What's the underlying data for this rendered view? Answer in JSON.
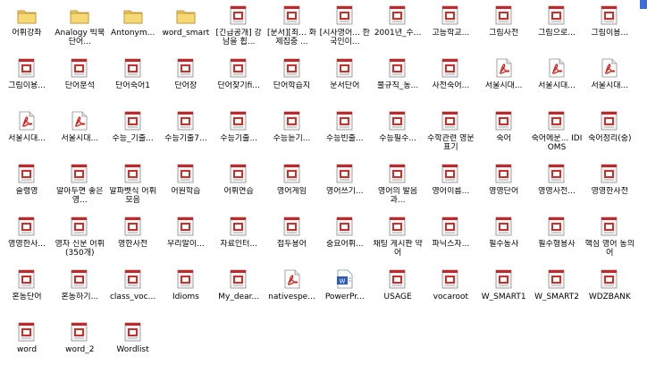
{
  "accent": "#3a6fd8",
  "items": [
    {
      "label": "어휘강좌",
      "type": "folder"
    },
    {
      "label": "Analogy 빅북단어...",
      "type": "folder"
    },
    {
      "label": "Antonym...",
      "type": "folder"
    },
    {
      "label": "word_smart",
      "type": "folder"
    },
    {
      "label": "[긴급공개] 강남을 휩...",
      "type": "doc"
    },
    {
      "label": "[문서][최... 화제집중 ...",
      "type": "doc"
    },
    {
      "label": "[시사영어... 한국인이...",
      "type": "doc"
    },
    {
      "label": "2001년_수...",
      "type": "doc"
    },
    {
      "label": "고등학교...",
      "type": "doc"
    },
    {
      "label": "그림사전",
      "type": "doc"
    },
    {
      "label": "그림으로...",
      "type": "doc"
    },
    {
      "label": "그림이용...",
      "type": "doc"
    },
    {
      "label": "그림이용...",
      "type": "doc"
    },
    {
      "label": "단어분석",
      "type": "doc"
    },
    {
      "label": "단어숙어1",
      "type": "doc"
    },
    {
      "label": "단어장",
      "type": "doc"
    },
    {
      "label": "단어찾기fi...",
      "type": "doc"
    },
    {
      "label": "단어학습지",
      "type": "doc"
    },
    {
      "label": "문서단어",
      "type": "doc"
    },
    {
      "label": "불규칙_동...",
      "type": "doc"
    },
    {
      "label": "사전숙어...",
      "type": "doc"
    },
    {
      "label": "서울시대...",
      "type": "pdf"
    },
    {
      "label": "서울시대...",
      "type": "pdf"
    },
    {
      "label": "서울시대...",
      "type": "pdf"
    },
    {
      "label": "서울시대...",
      "type": "pdf"
    },
    {
      "label": "서울시대...",
      "type": "pdf"
    },
    {
      "label": "수능_기출...",
      "type": "doc"
    },
    {
      "label": "수능기출7...",
      "type": "doc"
    },
    {
      "label": "수능기출...",
      "type": "doc"
    },
    {
      "label": "수능듣기...",
      "type": "doc"
    },
    {
      "label": "수능빈출...",
      "type": "doc"
    },
    {
      "label": "수능필수...",
      "type": "doc"
    },
    {
      "label": "수학관련 영문표기",
      "type": "doc"
    },
    {
      "label": "숙어",
      "type": "doc"
    },
    {
      "label": "숙어에문... IDIOMS",
      "type": "doc"
    },
    {
      "label": "숙어정리(중)",
      "type": "doc"
    },
    {
      "label": "슬랭영",
      "type": "doc"
    },
    {
      "label": "알아두면 좋은 영...",
      "type": "doc"
    },
    {
      "label": "알파벳식 어휘모음",
      "type": "doc"
    },
    {
      "label": "어원학습",
      "type": "doc"
    },
    {
      "label": "어휘연습",
      "type": "doc"
    },
    {
      "label": "영어게임",
      "type": "doc"
    },
    {
      "label": "영어쓰기...",
      "type": "doc"
    },
    {
      "label": "영어의 발음과...",
      "type": "doc"
    },
    {
      "label": "영어이름...",
      "type": "doc"
    },
    {
      "label": "영영단어",
      "type": "doc"
    },
    {
      "label": "영영사전...",
      "type": "doc"
    },
    {
      "label": "영영한사전",
      "type": "doc"
    },
    {
      "label": "영영한사...",
      "type": "doc"
    },
    {
      "label": "영자 신문 어휘 (350개)",
      "type": "doc"
    },
    {
      "label": "영한사전",
      "type": "doc"
    },
    {
      "label": "우리말이...",
      "type": "doc"
    },
    {
      "label": "자료인터...",
      "type": "doc"
    },
    {
      "label": "접두용어",
      "type": "doc"
    },
    {
      "label": "중요어휘...",
      "type": "doc"
    },
    {
      "label": "채팅 게시판 약어",
      "type": "doc"
    },
    {
      "label": "파닉스자...",
      "type": "doc"
    },
    {
      "label": "필수동사",
      "type": "doc"
    },
    {
      "label": "필수형용사",
      "type": "doc"
    },
    {
      "label": "핵심 영어 동의어",
      "type": "doc"
    },
    {
      "label": "혼동단어",
      "type": "doc"
    },
    {
      "label": "혼동하기...",
      "type": "doc"
    },
    {
      "label": "class_voc...",
      "type": "doc"
    },
    {
      "label": "Idioms",
      "type": "doc"
    },
    {
      "label": "My_dear...",
      "type": "doc"
    },
    {
      "label": "nativespe...",
      "type": "pdf"
    },
    {
      "label": "PowerPr...",
      "type": "word"
    },
    {
      "label": "USAGE",
      "type": "doc"
    },
    {
      "label": "vocaroot",
      "type": "doc"
    },
    {
      "label": "W_SMART1",
      "type": "doc"
    },
    {
      "label": "W_SMART2",
      "type": "doc"
    },
    {
      "label": "WDZBANK",
      "type": "doc"
    },
    {
      "label": "word",
      "type": "doc"
    },
    {
      "label": "word_2",
      "type": "doc"
    },
    {
      "label": "Wordlist",
      "type": "doc"
    }
  ]
}
